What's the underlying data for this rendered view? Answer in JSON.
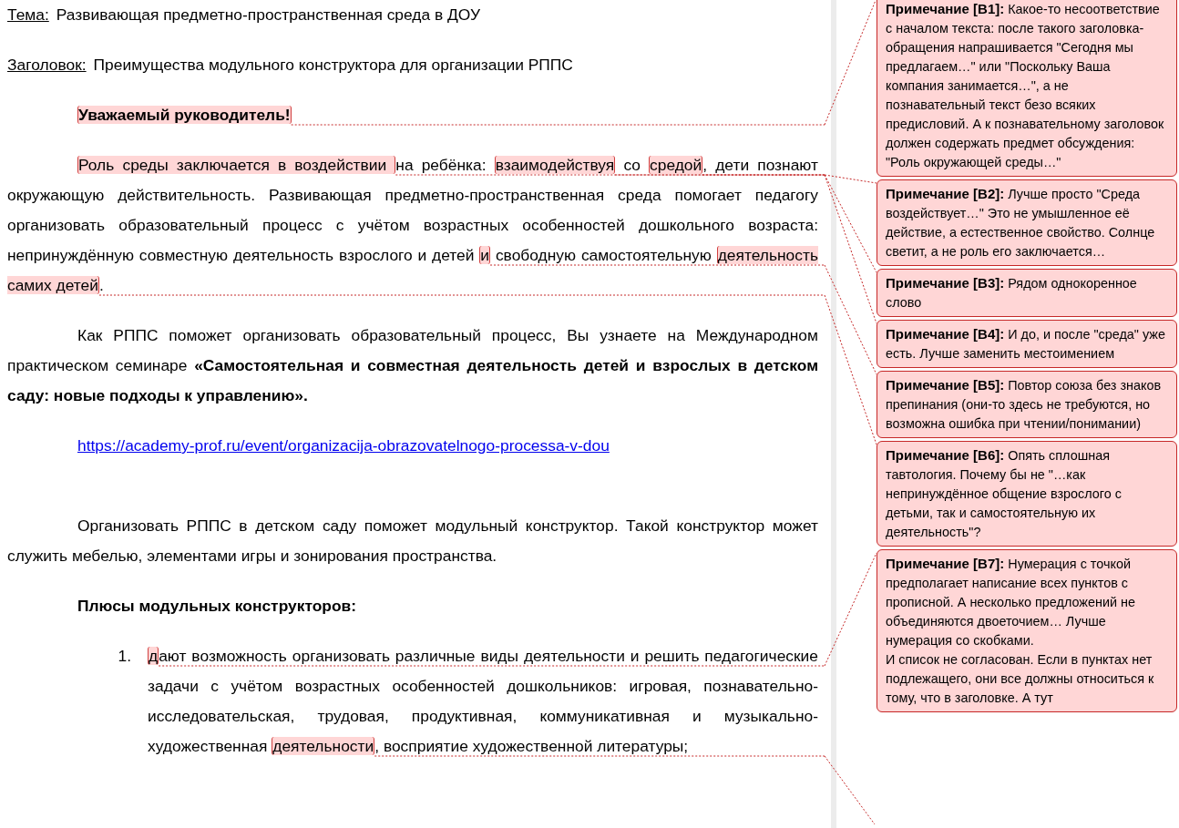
{
  "document": {
    "meta": [
      {
        "label": "Тема:",
        "value": "Развивающая предметно-пространственная среда в ДОУ"
      },
      {
        "label": "Заголовок:",
        "value": "Преимущества модульного конструктора для организации РППС"
      }
    ],
    "paragraphs": [
      {
        "kind": "greeting",
        "segments": [
          {
            "text": "Уважаемый руководитель!",
            "comment": true
          }
        ]
      },
      {
        "kind": "body",
        "segments": [
          {
            "text": "Роль среды заключается в воздействии ",
            "comment": true
          },
          {
            "text": "на ребёнка: ",
            "comment": false
          },
          {
            "text": "взаимодействуя",
            "comment": true
          },
          {
            "text": " со ",
            "comment": false
          },
          {
            "text": "средой",
            "comment": true
          },
          {
            "text": ", дети познают окружающую действительность. Развивающая предметно-пространственная среда помогает педагогу организовать образовательный процесс с учётом возрастных особенностей дошкольного возраста: непринуждённую совместную деятельность взрослого и детей ",
            "comment": false
          },
          {
            "text": "и",
            "comment": true
          },
          {
            "text": " свободную самостоятельную ",
            "comment": false
          },
          {
            "text": "деятельность самих детей",
            "comment": true
          },
          {
            "text": ".",
            "comment": false
          }
        ]
      },
      {
        "kind": "body",
        "segments": [
          {
            "text": "Как РППС поможет организовать образовательный процесс, Вы узнаете на Международном практическом семинаре **«Самостоятельная и совместная деятельность детей и взрослых в детском саду: новые подходы к управлению».**",
            "comment": false
          }
        ]
      },
      {
        "kind": "link",
        "segments": [
          {
            "text": "https://academy-prof.ru/event/organizacija-obrazovatelnogo-processa-v-dou",
            "comment": false
          }
        ]
      },
      {
        "kind": "body",
        "segments": [
          {
            "text": "Организовать РППС в детском саду поможет модульный конструктор. Такой конструктор может служить мебелью, элементами игры и зонирования пространства.",
            "comment": false
          }
        ]
      },
      {
        "kind": "heading",
        "segments": [
          {
            "text": "Плюсы модульных конструкторов:",
            "comment": false
          }
        ]
      },
      {
        "kind": "list-item",
        "number": "1.",
        "segments": [
          {
            "text": "д",
            "comment": true
          },
          {
            "text": "ают возможность организовать различные виды деятельности и решить педагогические задачи с учётом возрастных особенностей дошкольников: игровая, познавательно-исследовательская, трудовая, продуктивная, коммуникативная и музыкально-художественная ",
            "comment": false
          },
          {
            "text": "деятельности",
            "comment": true
          },
          {
            "text": ", восприятие художественной литературы;",
            "comment": false
          }
        ]
      }
    ]
  },
  "comments": [
    {
      "label": "Примечание [B1]:",
      "text": "Какое-то несоответствие с началом текста: после такого заголовка-обращения напрашивается \"Сегодня мы предлагаем…\" или \"Поскольку Ваша компания занимается…\", а не познавательный текст безо всяких предисловий. А к познавательному заголовок должен содержать предмет обсуждения: \"Роль окружающей среды…\""
    },
    {
      "label": "Примечание [B2]:",
      "text": "Лучше просто \"Среда воздействует…\" Это не умышленное её действие, а естественное свойство. Солнце светит, а не роль его заключается…"
    },
    {
      "label": "Примечание [B3]:",
      "text": "Рядом однокоренное слово"
    },
    {
      "label": "Примечание [B4]:",
      "text": "И до, и после \"среда\" уже есть. Лучше заменить местоимением"
    },
    {
      "label": "Примечание [B5]:",
      "text": "Повтор союза без знаков препинания (они-то здесь не требуются, но возможна ошибка при чтении/понимании)"
    },
    {
      "label": "Примечание [B6]:",
      "text": "Опять сплошная тавтология. Почему бы не \"…как непринуждённое общение взрослого с детьми, так и самостоятельную их деятельность\"?"
    },
    {
      "label": "Примечание [B7]:",
      "text": "Нумерация с точкой предполагает написание всех пунктов с прописной. А несколько предложений не объединяются двоеточием… Лучше нумерация со скобками.\nИ список не согласован. Если в пунктах нет подлежащего, они все должны относиться к тому, что в заголовке. А тут"
    }
  ]
}
